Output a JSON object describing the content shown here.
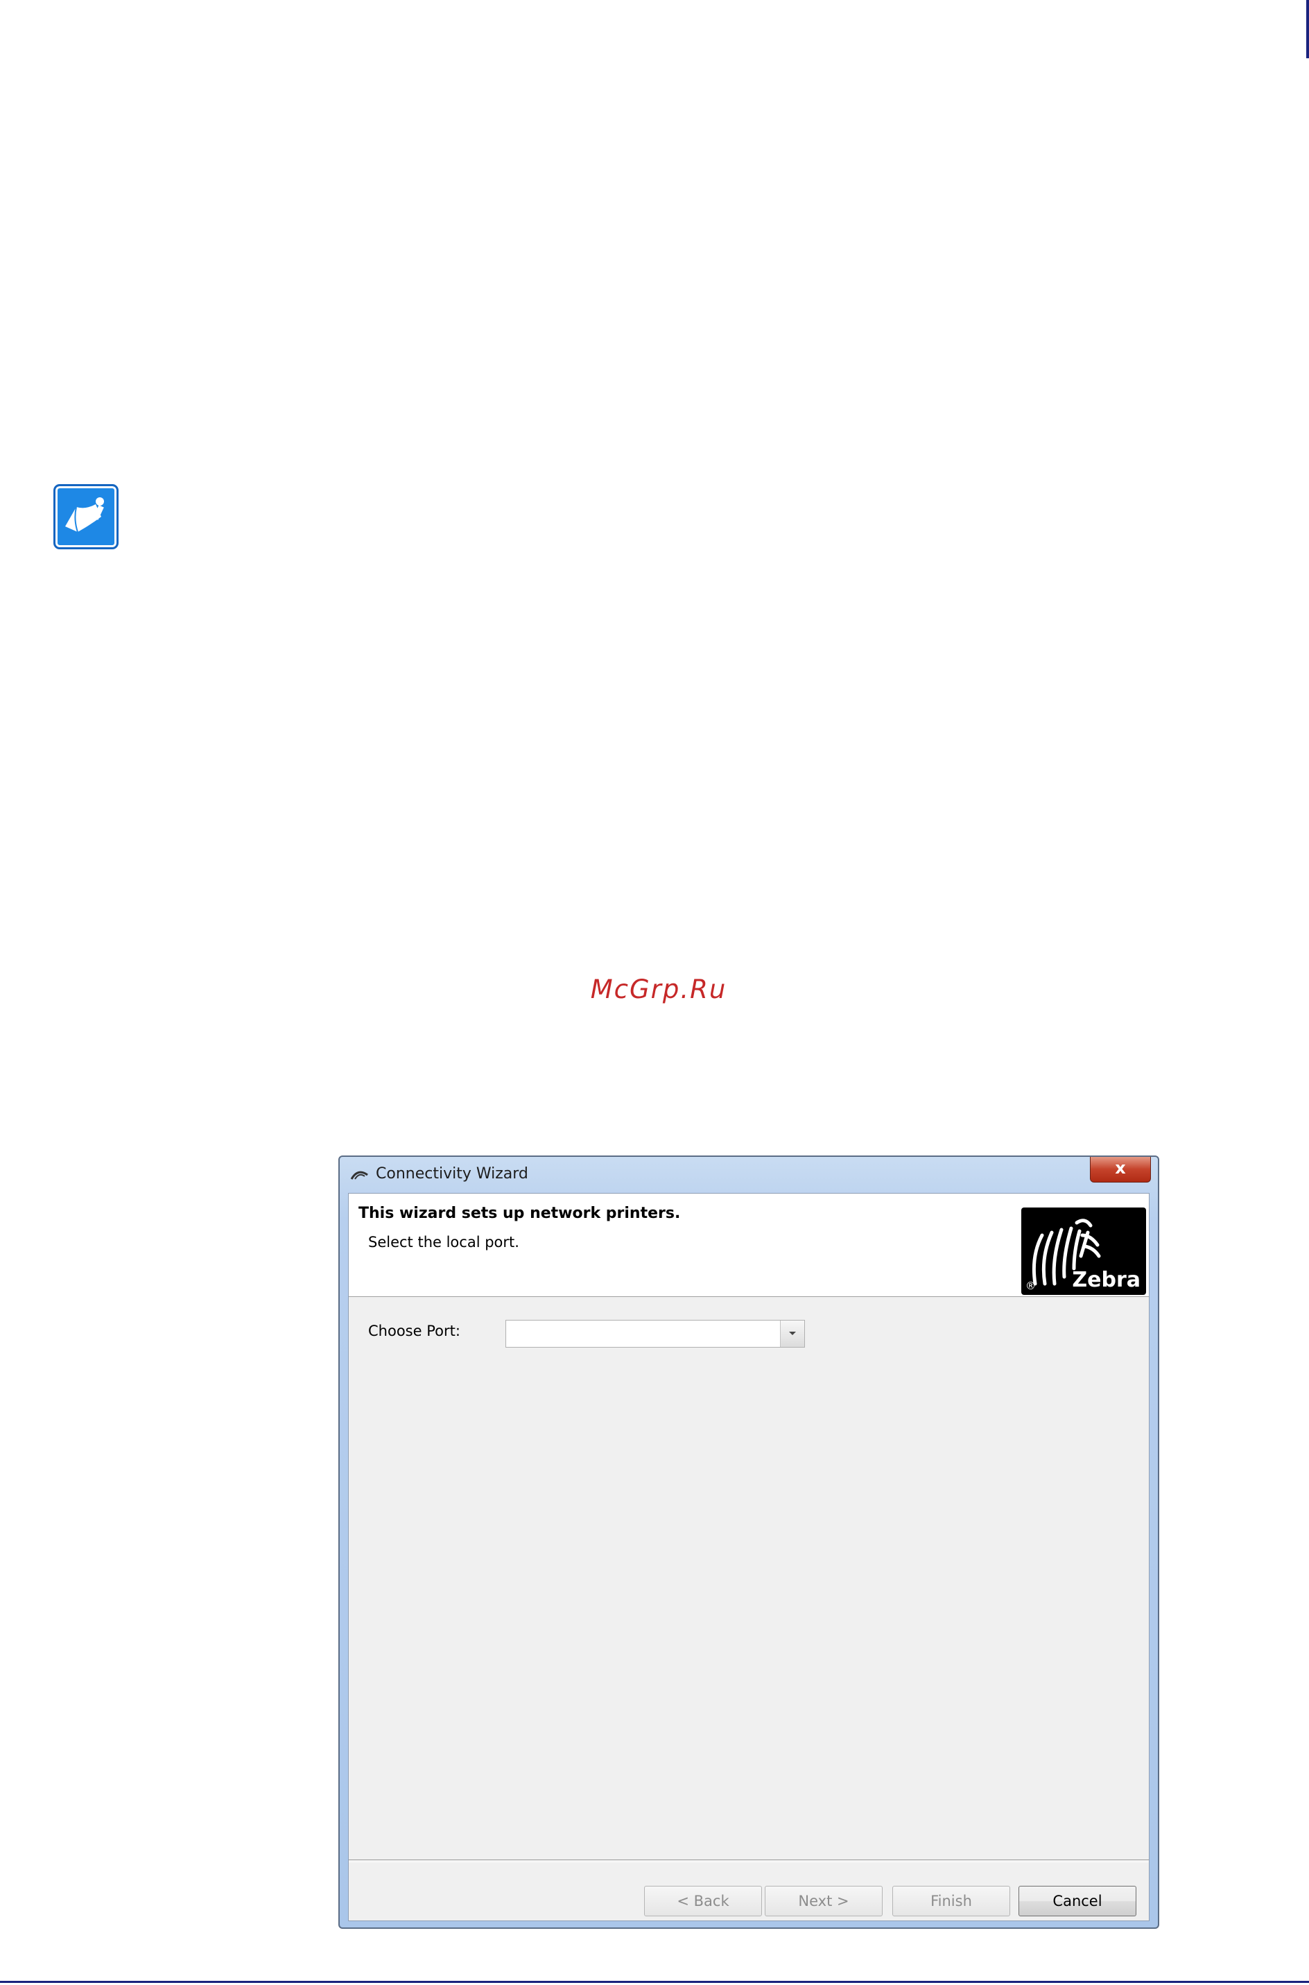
{
  "page": {
    "watermark": "McGrp.Ru",
    "note_icon": "note-pencil-icon"
  },
  "dialog": {
    "title": "Connectivity Wizard",
    "close_label": "x",
    "header_title": "This wizard sets up network printers.",
    "header_subtitle": "Select the local port.",
    "logo": {
      "word": "Zebra",
      "registered": "®"
    },
    "port_label": "Choose Port:",
    "port_value": "",
    "buttons": {
      "back": "< Back",
      "next": "Next >",
      "finish": "Finish",
      "cancel": "Cancel"
    }
  },
  "colors": {
    "accent": "#1a237e",
    "watermark": "#c62828",
    "note_icon": "#1e88e5"
  }
}
